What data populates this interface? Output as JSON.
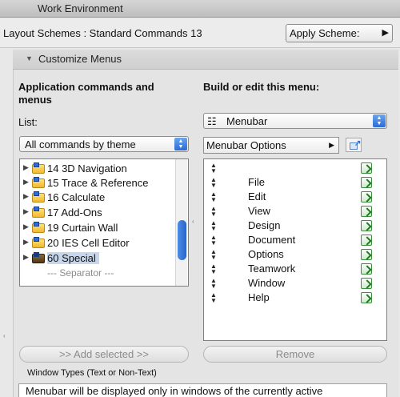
{
  "window": {
    "title": "Work Environment"
  },
  "schemes": {
    "label": "Layout Schemes : Standard Commands 13",
    "apply_button": "Apply Scheme:",
    "apply_arrow": "▶"
  },
  "section": {
    "title": "Customize Menus",
    "toggle_glyph": "▼"
  },
  "left": {
    "heading": "Application commands and menus",
    "list_label": "List:",
    "theme_select": "All commands by theme",
    "items": [
      {
        "label": "14 3D Navigation"
      },
      {
        "label": "15 Trace & Reference"
      },
      {
        "label": "16 Calculate"
      },
      {
        "label": "17 Add-Ons"
      },
      {
        "label": "19 Curtain Wall"
      },
      {
        "label": "20 IES Cell Editor"
      },
      {
        "label": "60 Special"
      }
    ],
    "separator": "--- Separator ---",
    "add_button": ">> Add selected >>"
  },
  "right": {
    "heading": "Build or edit this menu:",
    "menu_select": "Menubar",
    "menu_select_icon": "☷",
    "options_button": "Menubar Options",
    "menu_items": [
      "",
      "File",
      "Edit",
      "View",
      "Design",
      "Document",
      "Options",
      "Teamwork",
      "Window",
      "Help"
    ],
    "remove_button": "Remove"
  },
  "window_types": {
    "legend": "Window Types (Text or Non-Text)",
    "description": "Menubar will be displayed only in windows of the currently active"
  }
}
